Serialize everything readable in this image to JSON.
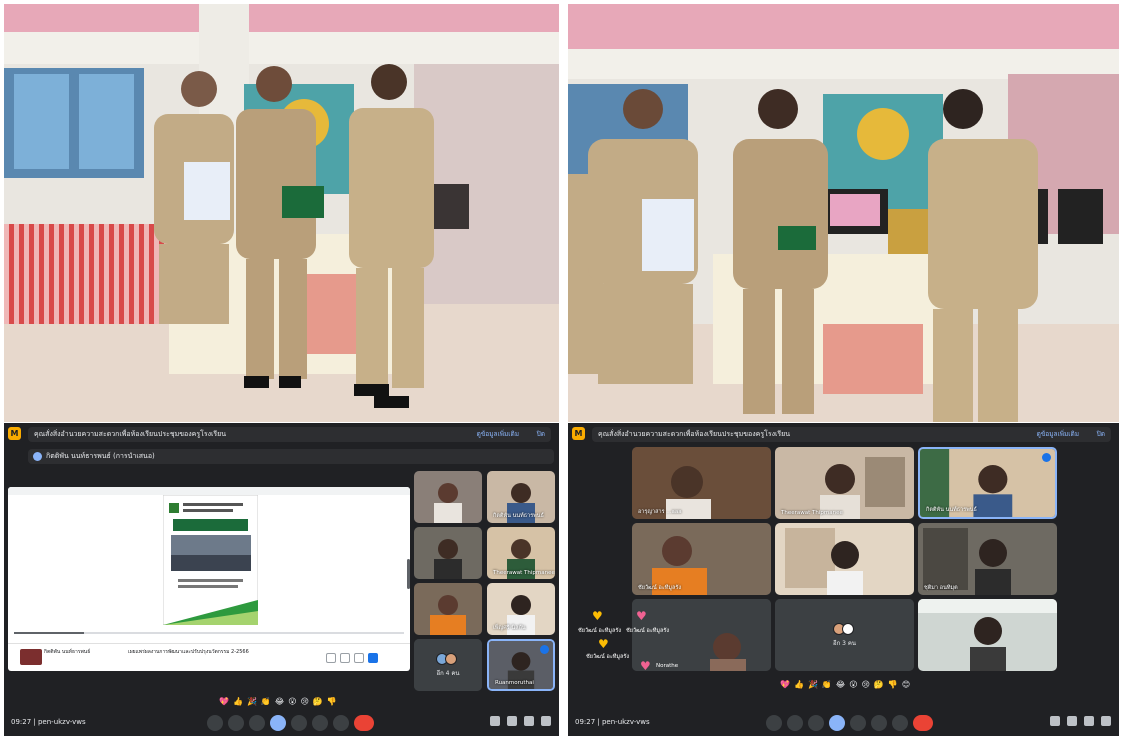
{
  "meet_left": {
    "banner_text": "คุณสั่งสิ่งอำนวยความสะดวกเพื่อห้องเรียนประชุมของครูโรงเรียน",
    "banner_link": "ดูข้อมูลเพิ่มเติม",
    "banner_close": "ปิด",
    "presenter": "กิตติพัน นนท์ธารพนธ์ (การนำเสนอ)",
    "shared_doc_owner": "กิตติพัน นนท์ธารพนธ์",
    "shared_doc_title": "เผยแพร่ผลงานการพัฒนาและปรับปรุงนวัตกรรม 2-2566",
    "tiles": [
      {
        "name": ""
      },
      {
        "name": "กิตติพัน นนท์ธารพนธ์"
      },
      {
        "name": ""
      },
      {
        "name": "Theerawat Thipmanee"
      },
      {
        "name": ""
      },
      {
        "name": "เพ็ญศรี นิลกัน"
      },
      {
        "name": "อีก 4 คน"
      },
      {
        "name": "Ruanmoruthai"
      }
    ],
    "reactions": [
      "💖",
      "👍",
      "🎉",
      "👏",
      "😂",
      "😮",
      "😢",
      "🤔",
      "👎"
    ],
    "clock": "09:27  |  pen-ukzv-vws"
  },
  "meet_right": {
    "banner_text": "คุณสั่งสิ่งอำนวยความสะดวกเพื่อห้องเรียนประชุมของครูโรงเรียน",
    "banner_link": "ดูข้อมูลเพิ่มเติม",
    "banner_close": "ปิด",
    "tiles": [
      {
        "name": "อารุญาสาร ...aaa"
      },
      {
        "name": "Theerawat Thipmanee"
      },
      {
        "name": "กิตติพัน นนท์ธารพนธ์"
      },
      {
        "name": "ชัยวัฒน์ อะทีมูลรัง"
      },
      {
        "name": ""
      },
      {
        "name": "ชุติมา อนทิมุต"
      },
      {
        "name": ""
      },
      {
        "name": "อีก 3 คน"
      },
      {
        "name": ""
      }
    ],
    "float_names": [
      "ชัยวัฒน์ อะทีมูลรัง",
      "ชัยวัฒน์ อะทีมูลรัง",
      "ชัยวัฒน์ อะทีมูลรัง",
      "Norathe"
    ],
    "reactions": [
      "💖",
      "👍",
      "🎉",
      "👏",
      "😂",
      "😮",
      "😢",
      "🤔",
      "👎",
      "😊"
    ],
    "clock": "09:27  |  pen-ukzv-vws"
  },
  "colors": {
    "meet_bg": "#202124",
    "end_call": "#ea4335",
    "uniform": "#c2ab86"
  }
}
